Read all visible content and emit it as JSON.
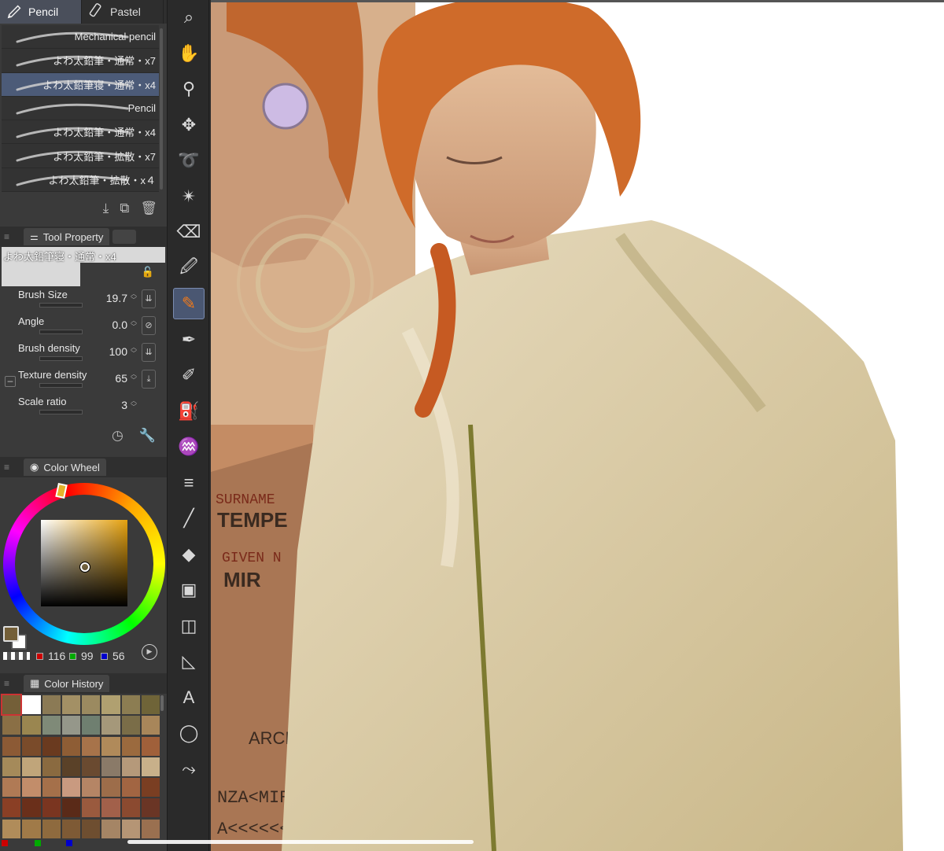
{
  "tabs": [
    {
      "label": "Pencil",
      "icon": "pencil-icon"
    },
    {
      "label": "Pastel",
      "icon": "pastel-icon"
    }
  ],
  "brushes": [
    {
      "label": "Mechanical pencil",
      "selected": false
    },
    {
      "label": "よわ太鉛筆・通常・x7",
      "selected": false
    },
    {
      "label": "よわ太鉛筆寝・通常・x4",
      "selected": true
    },
    {
      "label": "Pencil",
      "selected": false
    },
    {
      "label": "よわ太鉛筆・通常・x4",
      "selected": false
    },
    {
      "label": "よわ太鉛筆・拡散・x7",
      "selected": false
    },
    {
      "label": "よわ太鉛筆・拡散・x４",
      "selected": false
    }
  ],
  "tool_property": {
    "panel_label": "Tool Property",
    "preview_name": "よわ太鉛筆寝・通常・x4",
    "props": [
      {
        "label": "Brush Size",
        "value": "19.7"
      },
      {
        "label": "Angle",
        "value": "0.0"
      },
      {
        "label": "Brush density",
        "value": "100"
      },
      {
        "label": "Texture density",
        "value": "65"
      },
      {
        "label": "Scale ratio",
        "value": "3"
      }
    ]
  },
  "color_wheel": {
    "panel_label": "Color Wheel",
    "main_color": "#745f38",
    "sub_color": "#ffffff",
    "r": "116",
    "g": "99",
    "b": "56"
  },
  "color_history": {
    "panel_label": "Color History",
    "swatches": [
      "#745f38",
      "#ffffff",
      "#8b7a55",
      "#a39065",
      "#9b8a60",
      "#b0a070",
      "#8c7d52",
      "#6f6438",
      "#8a6f45",
      "#9a8650",
      "#7f8a78",
      "#95978a",
      "#6f7f70",
      "#a5987a",
      "#7a6d48",
      "#a8865a",
      "#8c5a35",
      "#7a4b2a",
      "#6a3a1f",
      "#8e5d35",
      "#a7734a",
      "#b08a5a",
      "#9b6a3e",
      "#a0603a",
      "#a58a5a",
      "#c0a57a",
      "#8a6a40",
      "#5a4128",
      "#6a4a30",
      "#8a7a68",
      "#b5997a",
      "#c8b08a",
      "#b07a55",
      "#c28d6a",
      "#a5704a",
      "#c99a80",
      "#b58565",
      "#9d6d4a",
      "#a26542",
      "#7a3e22",
      "#8a3f25",
      "#6a2f1a",
      "#7a3520",
      "#5a2a18",
      "#9a5a3e",
      "#a2604a",
      "#8b4a30",
      "#6a3525",
      "#b08c5a",
      "#a07a48",
      "#8e6a3e",
      "#7e5a35",
      "#6e4e30",
      "#a58565",
      "#b59575",
      "#9a7050"
    ],
    "bottom_dots": [
      "#cc0000",
      "#00aa00",
      "#0000cc"
    ]
  },
  "toolbar": [
    "search-icon",
    "hand-icon",
    "eyedropper-icon",
    "move-icon",
    "lasso-icon",
    "magic-wand-icon",
    "eraser-icon",
    "dropper-icon",
    "pencil-tool-icon",
    "pen-icon",
    "marker-icon",
    "airbrush-icon",
    "blend-icon",
    "hatching-icon",
    "line-icon",
    "fill-icon",
    "gradient-icon",
    "frame-icon",
    "ruler-icon",
    "text-icon",
    "balloon-icon",
    "correct-line-icon"
  ],
  "canvas": {
    "texts": [
      "SURNAME",
      "TEMPE",
      "GIVEN N",
      "MIR",
      "ARCHITECT",
      "NZA<MIRO<<<<<",
      "A<<<<<<<<<<<<<"
    ]
  }
}
